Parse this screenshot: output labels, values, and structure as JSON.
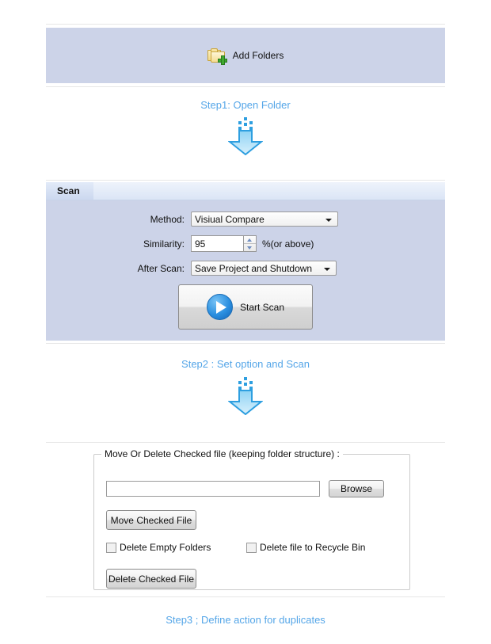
{
  "step1": {
    "caption": "Step1: Open Folder",
    "add_folders_label": "Add Folders",
    "add_folders_icon": "add-folder-icon"
  },
  "step2": {
    "caption": "Step2 : Set option and Scan",
    "panel_title": "Scan",
    "method_label": "Method:",
    "method_value": "Visiual Compare",
    "similarity_label": "Similarity:",
    "similarity_value": "95",
    "similarity_unit": "%(or above)",
    "after_scan_label": "After Scan:",
    "after_scan_value": "Save Project and Shutdown",
    "start_scan_label": "Start Scan",
    "play_icon": "play-icon"
  },
  "step3": {
    "caption": "Step3 ; Define action for duplicates",
    "group_legend": "Move Or Delete Checked file (keeping folder structure) :",
    "path_value": "",
    "path_placeholder": "",
    "browse_label": "Browse",
    "move_checked_label": "Move Checked File",
    "delete_empty_folders_label": "Delete Empty Folders",
    "delete_recycle_bin_label": "Delete file to Recycle Bin",
    "delete_checked_label": "Delete Checked File",
    "delete_empty_folders_checked": false,
    "delete_recycle_bin_checked": false
  },
  "colors": {
    "caption_blue": "#55a6e8",
    "panel_fill": "#ccd3e8",
    "arrow_blue": "#2e9fe0",
    "accent_play": "#2a8fe0"
  }
}
